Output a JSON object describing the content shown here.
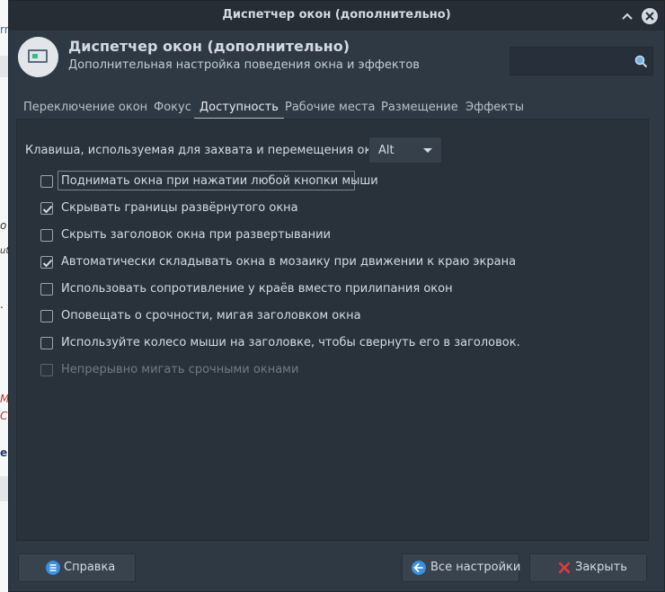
{
  "window": {
    "title": "Диспетчер окон (дополнительно)"
  },
  "header": {
    "app_title": "Диспетчер окон (дополнительно)",
    "app_subtitle": "Дополнительная настройка поведения окна и эффектов",
    "search_value": ""
  },
  "tabs": [
    {
      "label": "Переключение окон",
      "active": false
    },
    {
      "label": "Фокус",
      "active": false
    },
    {
      "label": "Доступность",
      "active": true
    },
    {
      "label": "Рабочие места",
      "active": false
    },
    {
      "label": "Размещение",
      "active": false
    },
    {
      "label": "Эффекты",
      "active": false
    }
  ],
  "accessibility": {
    "key_label": "Клавиша, используемая для захвата и перемещения окон:",
    "key_value": "Alt",
    "options": [
      {
        "label": "Поднимать окна при нажатии любой кнопки мыши",
        "checked": false,
        "enabled": true,
        "focused": true
      },
      {
        "label": "Скрывать границы развёрнутого окна",
        "checked": true,
        "enabled": true,
        "focused": false
      },
      {
        "label": "Скрыть заголовок окна при развертывании",
        "checked": false,
        "enabled": true,
        "focused": false
      },
      {
        "label": "Автоматически складывать окна в мозаику при движении к краю экрана",
        "checked": true,
        "enabled": true,
        "focused": false
      },
      {
        "label": "Использовать сопротивление у краёв вместо прилипания окон",
        "checked": false,
        "enabled": true,
        "focused": false
      },
      {
        "label": "Оповещать о срочности, мигая заголовком окна",
        "checked": false,
        "enabled": true,
        "focused": false
      },
      {
        "label": "Используйте колесо мыши на заголовке, чтобы свернуть его в заголовок.",
        "checked": false,
        "enabled": true,
        "focused": false
      },
      {
        "label": "Непрерывно мигать срочными окнами",
        "checked": false,
        "enabled": false,
        "focused": false
      }
    ]
  },
  "footer": {
    "help_label": "Справка",
    "all_settings_label": "Все настройки",
    "close_label": "Закрыть"
  },
  "background": {
    "fragments": [
      "rr",
      "o",
      "ut",
      ".",
      "MC",
      "Co",
      "e"
    ]
  },
  "colors": {
    "window_bg": "#2f3943",
    "titlebar_bg": "#262d35",
    "help_icon": "#3d8fe0",
    "settings_icon": "#3d8fe0",
    "close_icon": "#e0393e"
  }
}
